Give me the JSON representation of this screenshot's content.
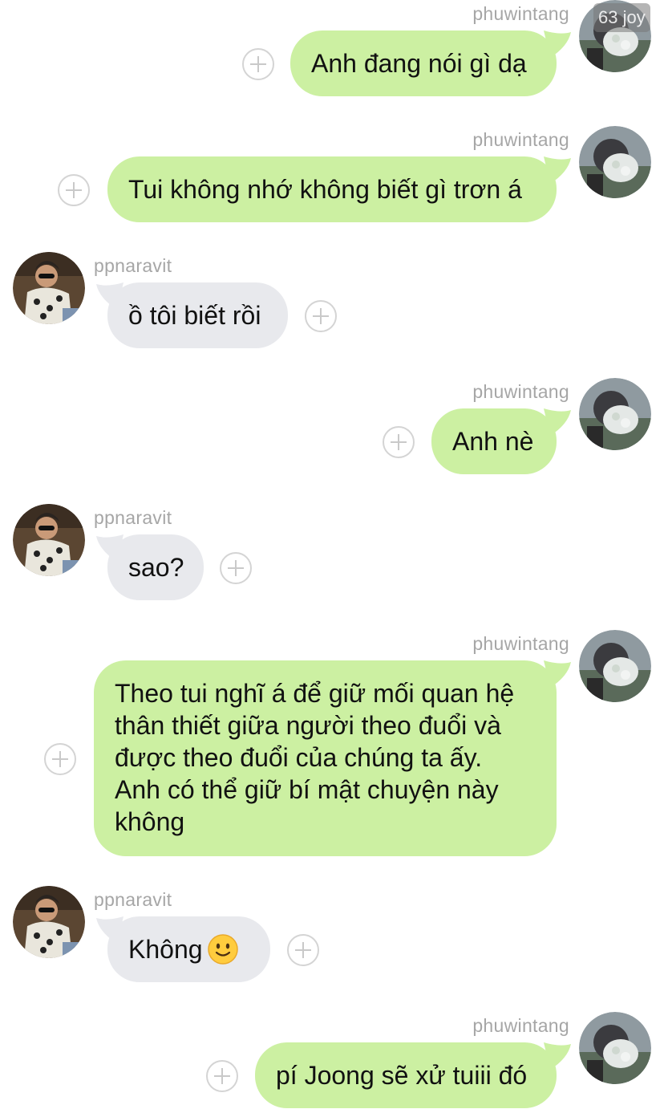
{
  "chat": {
    "messages": [
      {
        "sender": "phuwintang",
        "direction": "outgoing",
        "text": "Anh đang nói gì dạ"
      },
      {
        "sender": "phuwintang",
        "direction": "outgoing",
        "text": "Tui không nhớ không biết gì trơn á"
      },
      {
        "sender": "ppnaravit",
        "direction": "incoming",
        "text": "ồ tôi biết rồi"
      },
      {
        "sender": "phuwintang",
        "direction": "outgoing",
        "text": "Anh nè"
      },
      {
        "sender": "ppnaravit",
        "direction": "incoming",
        "text": "sao?"
      },
      {
        "sender": "phuwintang",
        "direction": "outgoing",
        "text": "Theo tui nghĩ á để giữ mối quan hệ\nthân thiết giữa người theo đuổi và\nđược theo đuổi của chúng ta ấy.\nAnh có thể giữ bí mật chuyện này\nkhông"
      },
      {
        "sender": "ppnaravit",
        "direction": "incoming",
        "text": "Không",
        "emoji": "slightly-smiling-face-icon"
      },
      {
        "sender": "phuwintang",
        "direction": "outgoing",
        "text": "pí Joong sẽ xử tuiii đó"
      }
    ]
  },
  "overlay_badge": "63 joy",
  "colors": {
    "outgoing_bubble": "#ccf0a2",
    "incoming_bubble": "#e8e9ed",
    "username_gray": "#a6a6a6",
    "react_circle": "#d4d4d4"
  }
}
